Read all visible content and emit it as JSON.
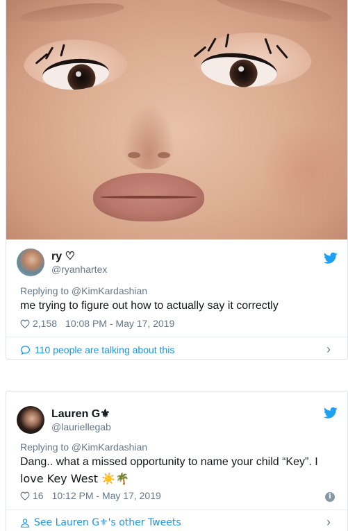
{
  "tweet1": {
    "display_name": "ry ♡",
    "handle": "@ryanhartex",
    "replying_to": "Replying to @KimKardashian",
    "text": "me trying to figure out how to actually say it correctly",
    "likes": "2,158",
    "timestamp": "10:08 PM - May 17, 2019",
    "conversation": "110 people are talking about this",
    "icons": [
      "twitter-bird-icon",
      "heart-icon",
      "speech-bubble-icon",
      "chevron-right-icon"
    ]
  },
  "tweet2": {
    "display_name": "Lauren G⚜",
    "handle": "@lauriellegab",
    "replying_to": "Replying to @KimKardashian",
    "text_line1": "Dang.. what a missed opportunity to name your child “Key”. I",
    "text_line2": "love Key West ☀️🌴",
    "likes": "16",
    "timestamp": "10:12 PM - May 17, 2019",
    "other_tweets_link": "See Lauren G⚜'s other Tweets",
    "icons": [
      "twitter-bird-icon",
      "heart-icon",
      "info-icon",
      "person-icon",
      "chevron-right-icon"
    ]
  },
  "colors": {
    "link": "#1b95e0",
    "muted": "#657786",
    "border": "#e6ecf0",
    "twitter_blue": "#1da1f2"
  }
}
